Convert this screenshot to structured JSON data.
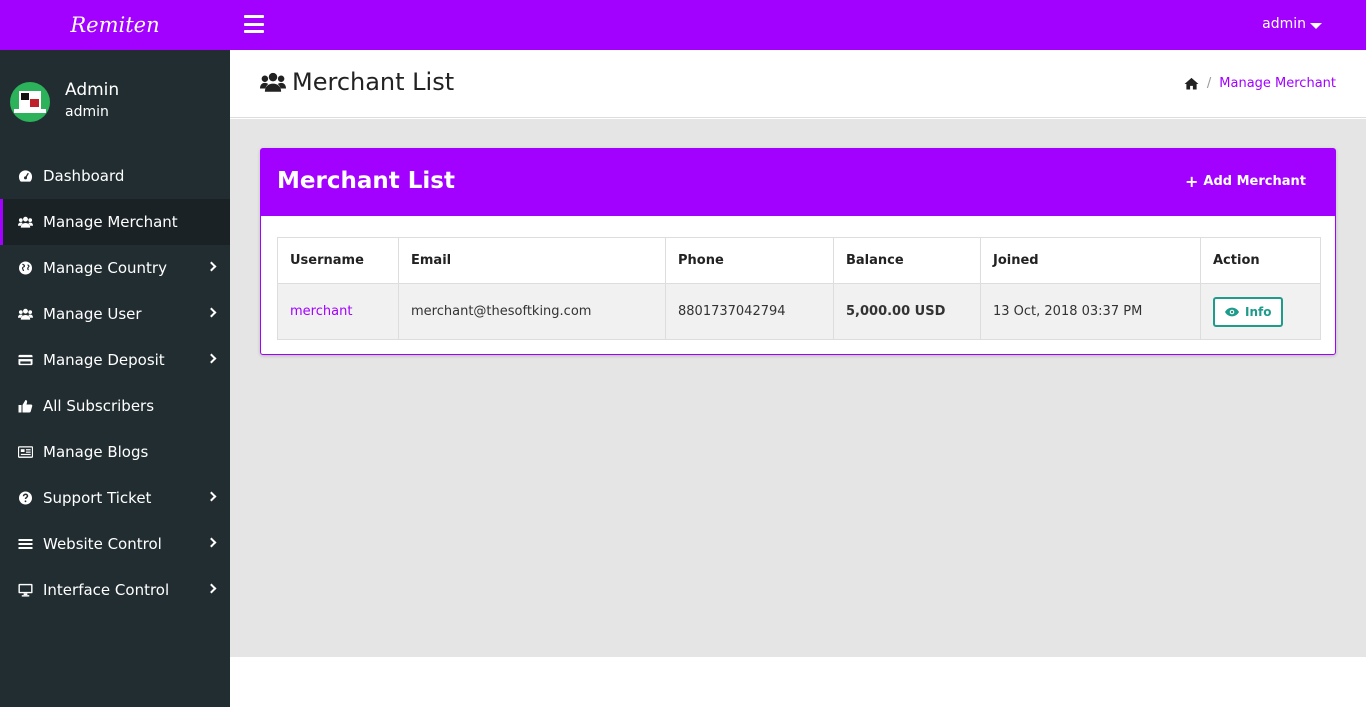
{
  "brand": {
    "name": "Remiten"
  },
  "topbar": {
    "user_label": "admin"
  },
  "profile": {
    "name": "Admin",
    "role": "admin"
  },
  "sidebar": {
    "items": [
      {
        "label": "Dashboard",
        "icon": "dashboard-icon",
        "active": false,
        "has_arrow": false
      },
      {
        "label": "Manage Merchant",
        "icon": "users-icon",
        "active": true,
        "has_arrow": false
      },
      {
        "label": "Manage Country",
        "icon": "globe-icon",
        "active": false,
        "has_arrow": true
      },
      {
        "label": "Manage User",
        "icon": "users-icon",
        "active": false,
        "has_arrow": true
      },
      {
        "label": "Manage Deposit",
        "icon": "credit-card-icon",
        "active": false,
        "has_arrow": true
      },
      {
        "label": "All Subscribers",
        "icon": "thumbs-up-icon",
        "active": false,
        "has_arrow": false
      },
      {
        "label": "Manage Blogs",
        "icon": "newspaper-icon",
        "active": false,
        "has_arrow": false
      },
      {
        "label": "Support Ticket",
        "icon": "question-circle-icon",
        "active": false,
        "has_arrow": true
      },
      {
        "label": "Website Control",
        "icon": "bars-icon",
        "active": false,
        "has_arrow": true
      },
      {
        "label": "Interface Control",
        "icon": "desktop-icon",
        "active": false,
        "has_arrow": true
      }
    ]
  },
  "header": {
    "title": "Merchant List",
    "breadcrumb": {
      "current": "Manage Merchant"
    }
  },
  "card": {
    "title": "Merchant List",
    "add_button": "Add Merchant"
  },
  "table": {
    "columns": [
      "Username",
      "Email",
      "Phone",
      "Balance",
      "Joined",
      "Action"
    ],
    "rows": [
      {
        "username": "merchant",
        "email": "merchant@thesoftking.com",
        "phone": "8801737042794",
        "balance": "5,000.00 USD",
        "joined": "13 Oct, 2018 03:37 PM",
        "action": "Info"
      }
    ]
  },
  "colors": {
    "accent": "#a200ff",
    "sidebar_bg": "#222d32",
    "info_button": "#1e9b8a"
  }
}
